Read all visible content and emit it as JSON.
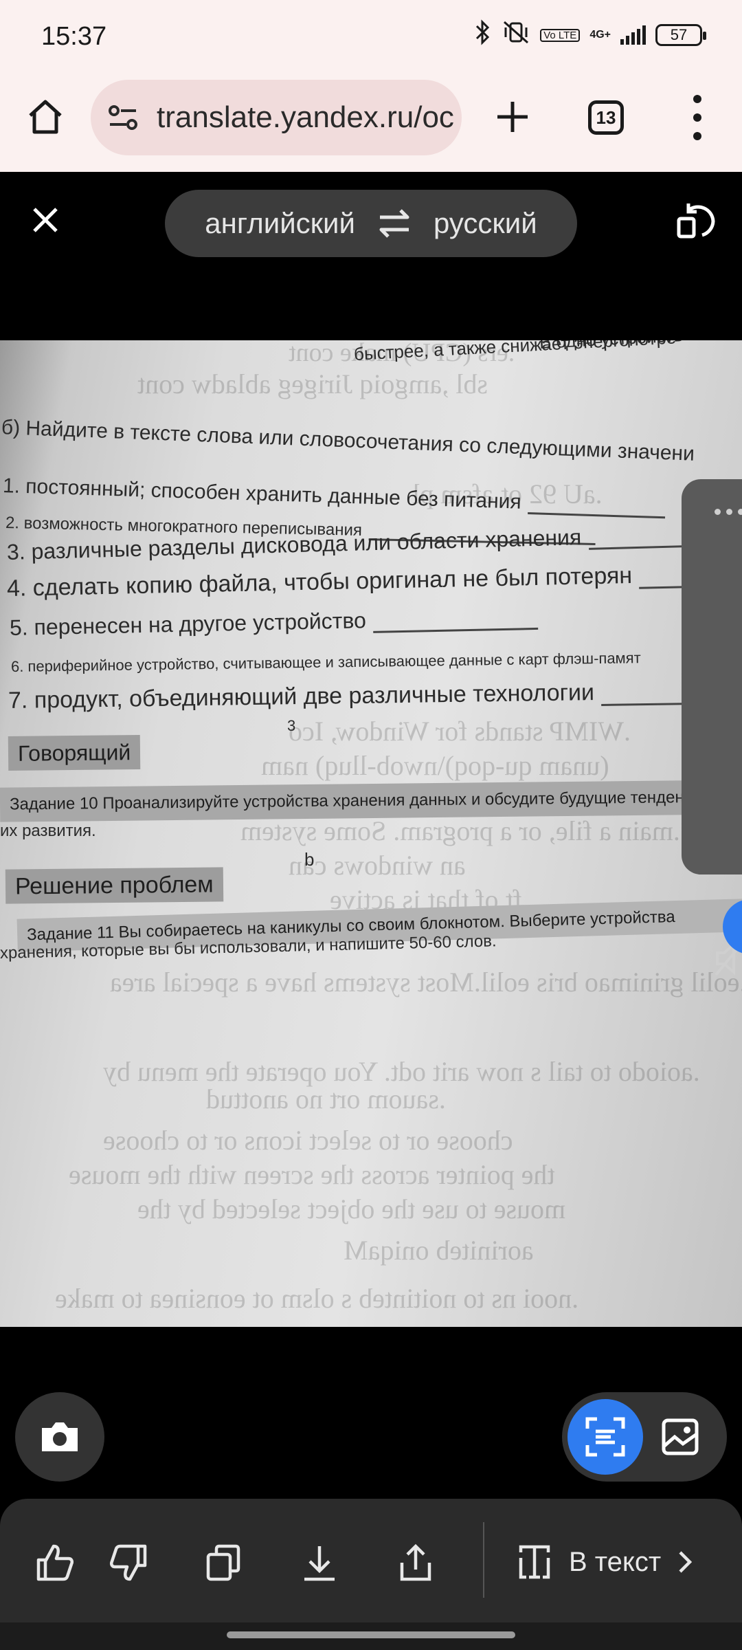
{
  "status_bar": {
    "time": "15:37",
    "network": "4G+",
    "lte_badge": "Vo LTE",
    "battery": "57"
  },
  "browser": {
    "url": "translate.yandex.ru/oc",
    "tab_count": "13"
  },
  "translator": {
    "source_language": "английский",
    "target_language": "русский"
  },
  "photo_text": {
    "top_line": "быстрее, а также снижает энергопотре",
    "top_line_right": "В одно устройств",
    "task_b": "б) Найдите в тексте слова или словосочетания со следующими значени",
    "items": [
      "1. постоянный; способен хранить данные без питания",
      "2. возможность многократного переписывания",
      "3. различные разделы дисковода или области хранения",
      "4. сделать копию файла, чтобы оригинал не был потерян",
      "5. перенесен на другое устройство",
      "6. периферийное устройство, считывающее и записывающее данные с карт флэш-памят",
      "7. продукт, объединяющий две различные технологии"
    ],
    "page_num": "3",
    "speaking_heading": "Говорящий",
    "task10_line1": "Задание 10 Проанализируйте устройства хранения данных и обсудите будущие тенденци",
    "task10_line2": "их развития.",
    "letter_b": "b",
    "problem_heading": "Решение проблем",
    "task11_line1": "Задание 11 Вы собираетесь на каникулы со своим блокнотом. Выберите устройства",
    "task11_line2": "хранения, которые вы бы использовали, и напишите 50-60 слов."
  },
  "toolbar": {
    "to_text_label": "В текст"
  }
}
